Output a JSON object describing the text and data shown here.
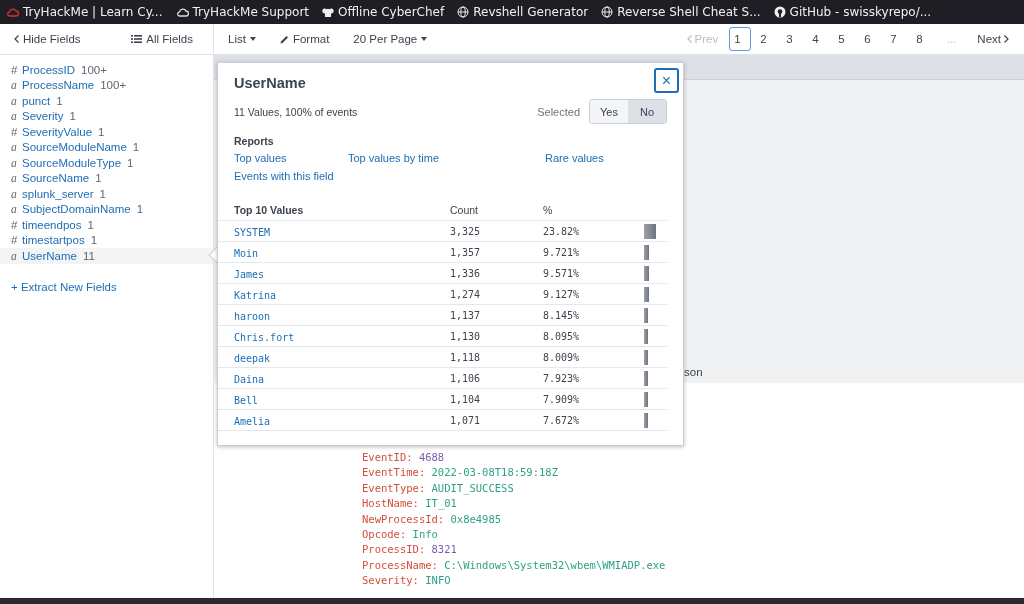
{
  "bookmarks": [
    {
      "label": "TryHackMe | Learn Cy..."
    },
    {
      "label": "TryHackMe Support"
    },
    {
      "label": "Offline CyberChef"
    },
    {
      "label": "Revshell Generator"
    },
    {
      "label": "Reverse Shell Cheat S..."
    },
    {
      "label": "GitHub - swisskyrepo/..."
    }
  ],
  "toolbar": {
    "hide_fields": "Hide Fields",
    "all_fields": "All Fields",
    "list": "List",
    "format": "Format",
    "per_page": "20 Per Page"
  },
  "pagination": {
    "prev": {
      "label": "Prev",
      "disabled": true
    },
    "pages": [
      {
        "label": "1",
        "selected": true
      },
      {
        "label": "2",
        "selected": false
      },
      {
        "label": "3",
        "selected": false
      },
      {
        "label": "4",
        "selected": false
      },
      {
        "label": "5",
        "selected": false
      },
      {
        "label": "6",
        "selected": false
      },
      {
        "label": "7",
        "selected": false
      },
      {
        "label": "8",
        "selected": false
      }
    ],
    "ellipsis": "...",
    "next": {
      "label": "Next",
      "disabled": false
    }
  },
  "sidebar": {
    "fields": [
      {
        "type": "#",
        "name": "ProcessID",
        "count": "100+",
        "selected": false
      },
      {
        "type": "a",
        "name": "ProcessName",
        "count": "100+",
        "selected": false
      },
      {
        "type": "a",
        "name": "punct",
        "count": "1",
        "selected": false
      },
      {
        "type": "a",
        "name": "Severity",
        "count": "1",
        "selected": false
      },
      {
        "type": "#",
        "name": "SeverityValue",
        "count": "1",
        "selected": false
      },
      {
        "type": "a",
        "name": "SourceModuleName",
        "count": "1",
        "selected": false
      },
      {
        "type": "a",
        "name": "SourceModuleType",
        "count": "1",
        "selected": false
      },
      {
        "type": "a",
        "name": "SourceName",
        "count": "1",
        "selected": false
      },
      {
        "type": "a",
        "name": "splunk_server",
        "count": "1",
        "selected": false
      },
      {
        "type": "a",
        "name": "SubjectDomainName",
        "count": "1",
        "selected": false
      },
      {
        "type": "#",
        "name": "timeendpos",
        "count": "1",
        "selected": false
      },
      {
        "type": "#",
        "name": "timestartpos",
        "count": "1",
        "selected": false
      },
      {
        "type": "a",
        "name": "UserName",
        "count": "11",
        "selected": true
      }
    ],
    "extract": "+ Extract New Fields"
  },
  "results": {
    "partial_text": "son"
  },
  "event": [
    {
      "key": "EventID:",
      "value": "4688",
      "kind": "number"
    },
    {
      "key": "EventTime:",
      "value": "2022-03-08T18:59:18Z",
      "kind": "string"
    },
    {
      "key": "EventType:",
      "value": "AUDIT_SUCCESS",
      "kind": "string"
    },
    {
      "key": "HostName:",
      "value": "IT_01",
      "kind": "string"
    },
    {
      "key": "NewProcessId:",
      "value": "0x8e4985",
      "kind": "string"
    },
    {
      "key": "Opcode:",
      "value": "Info",
      "kind": "string"
    },
    {
      "key": "ProcessID:",
      "value": "8321",
      "kind": "number"
    },
    {
      "key": "ProcessName:",
      "value": "C:\\Windows\\System32\\wbem\\WMIADP.exe",
      "kind": "string"
    },
    {
      "key": "Severity:",
      "value": "INFO",
      "kind": "string"
    }
  ],
  "popup": {
    "title": "UserName",
    "close": "×",
    "summary": "11 Values, 100% of events",
    "selected_label": "Selected",
    "toggle": [
      {
        "label": "Yes",
        "selected": false
      },
      {
        "label": "No",
        "selected": true
      }
    ],
    "reports_title": "Reports",
    "reports": [
      "Top values",
      "Top values by time",
      "Rare values",
      "Events with this field"
    ],
    "columns": [
      "Top 10 Values",
      "Count",
      "%"
    ],
    "rows": [
      {
        "value": "SYSTEM",
        "count": "3,325",
        "percent": "23.82%"
      },
      {
        "value": "Moin",
        "count": "1,357",
        "percent": "9.721%"
      },
      {
        "value": "James",
        "count": "1,336",
        "percent": "9.571%"
      },
      {
        "value": "Katrina",
        "count": "1,274",
        "percent": "9.127%"
      },
      {
        "value": "haroon",
        "count": "1,137",
        "percent": "8.145%"
      },
      {
        "value": "Chris.fort",
        "count": "1,130",
        "percent": "8.095%"
      },
      {
        "value": "deepak",
        "count": "1,118",
        "percent": "8.009%"
      },
      {
        "value": "Daina",
        "count": "1,106",
        "percent": "7.923%"
      },
      {
        "value": "Bell",
        "count": "1,104",
        "percent": "7.909%"
      },
      {
        "value": "Amelia",
        "count": "1,071",
        "percent": "7.672%"
      }
    ]
  }
}
